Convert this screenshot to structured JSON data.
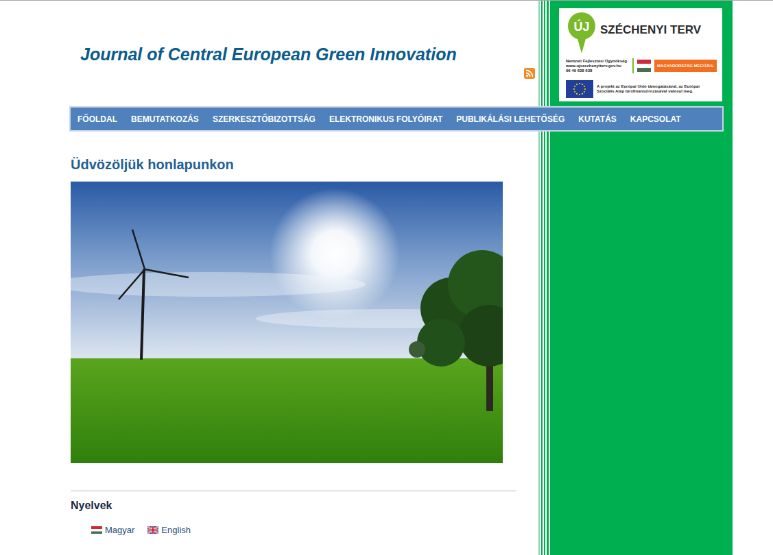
{
  "header": {
    "title": "Journal of Central European Green Innovation"
  },
  "logo": {
    "badge": "ÚJ",
    "name": "SZÉCHENYI TERV",
    "agency": "Nemzeti Fejlesztési Ügynökség",
    "url": "www.ujszechenyiterv.gov.hu",
    "phone": "06 40 638 638",
    "slogan": "MAGYARORSZÁG MEGÚJUL",
    "eu_note": "A projekt az Európai Unió támogatásával, az Európai Szociális Alap társfinanszírozásával valósul meg."
  },
  "nav": [
    "FŐOLDAL",
    "BEMUTATKOZÁS",
    "SZERKESZTŐBIZOTTSÁG",
    "ELEKTRONIKUS FOLYÓIRAT",
    "PUBLIKÁLÁSI LEHETŐSÉG",
    "KUTATÁS",
    "KAPCSOLAT"
  ],
  "welcome": {
    "heading": "Üdvözöljük honlapunkon"
  },
  "languages": {
    "heading": "Nyelvek",
    "items": [
      {
        "label": "Magyar",
        "kind": "hu"
      },
      {
        "label": "English",
        "kind": "uk"
      }
    ]
  }
}
